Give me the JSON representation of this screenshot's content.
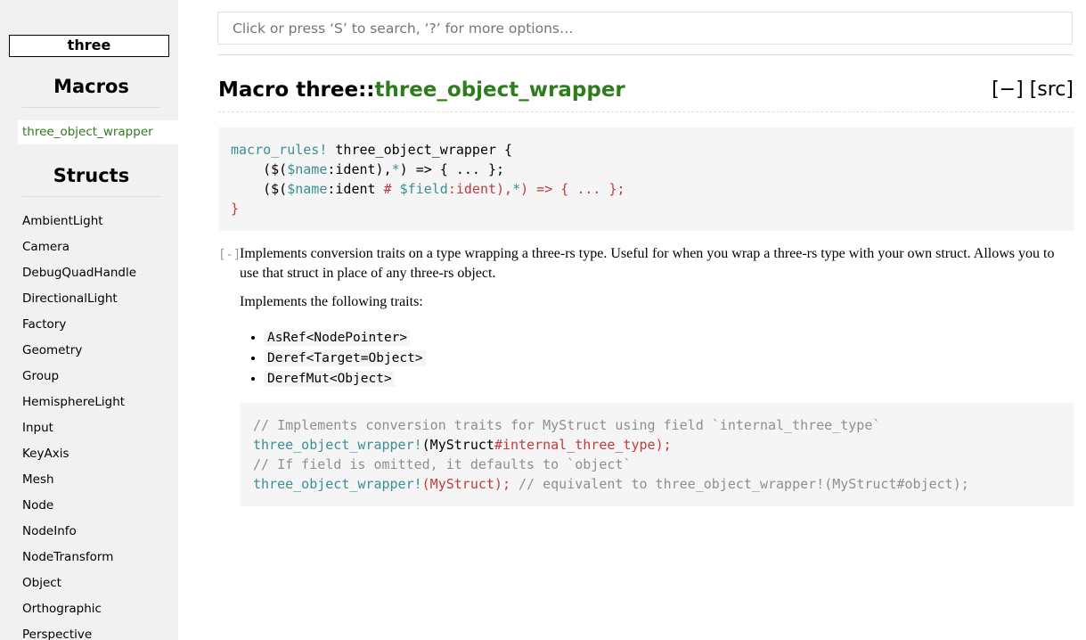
{
  "sidebar": {
    "crate": "three",
    "macros_heading": "Macros",
    "macro_items": [
      "three_object_wrapper"
    ],
    "structs_heading": "Structs",
    "structs": [
      "AmbientLight",
      "Camera",
      "DebugQuadHandle",
      "DirectionalLight",
      "Factory",
      "Geometry",
      "Group",
      "HemisphereLight",
      "Input",
      "KeyAxis",
      "Mesh",
      "Node",
      "NodeInfo",
      "NodeTransform",
      "Object",
      "Orthographic",
      "Perspective"
    ]
  },
  "search": {
    "placeholder": "Click or press ‘S’ to search, ‘?’ for more options…"
  },
  "header": {
    "title_prefix": "Macro three::",
    "title_name": "three_object_wrapper",
    "collapse_label": "[−]",
    "src_label": "[src]"
  },
  "declaration": {
    "line1_kw": "macro_rules!",
    "line1_rest": " three_object_wrapper {",
    "line2_a": "    ($(",
    "line2_var": "$name",
    "line2_b": ":ident),",
    "line2_star": "*",
    "line2_c": ") => { ... };",
    "line3_a": "    ($(",
    "line3_var1": "$name",
    "line3_b": ":ident ",
    "line3_hash": "# ",
    "line3_var2": "$field",
    "line3_c": ":ident),",
    "line3_star": "*",
    "line3_d": ") => { ... };",
    "line4": "}"
  },
  "doc": {
    "toggle": "[-]",
    "paragraph1": "Implements conversion traits on a type wrapping a three-rs type. Useful for when you wrap a three-rs type with your own struct. Allows you to use that struct in place of any three-rs object.",
    "paragraph2": "Implements the following traits:",
    "traits": [
      "AsRef<NodePointer>",
      "Deref<Target=Object>",
      "DerefMut<Object>"
    ]
  },
  "example": {
    "line1": "// Implements conversion traits for MyStruct using field `internal_three_type`",
    "line2_mac": "three_object_wrapper!",
    "line2_a": "(MyStruct",
    "line2_b": "#internal_three_type",
    "line2_c": ");",
    "line3": "// If field is omitted, it defaults to `object`",
    "line4_mac": "three_object_wrapper!",
    "line4_a": "(MyStruct);",
    "line4_cm": " // equivalent to three_object_wrapper!(MyStruct#object);"
  },
  "colors": {
    "macro_green": "#2e7d1d",
    "sidebar_bg": "#f1f1f1",
    "code_bg": "#f5f5f5"
  }
}
